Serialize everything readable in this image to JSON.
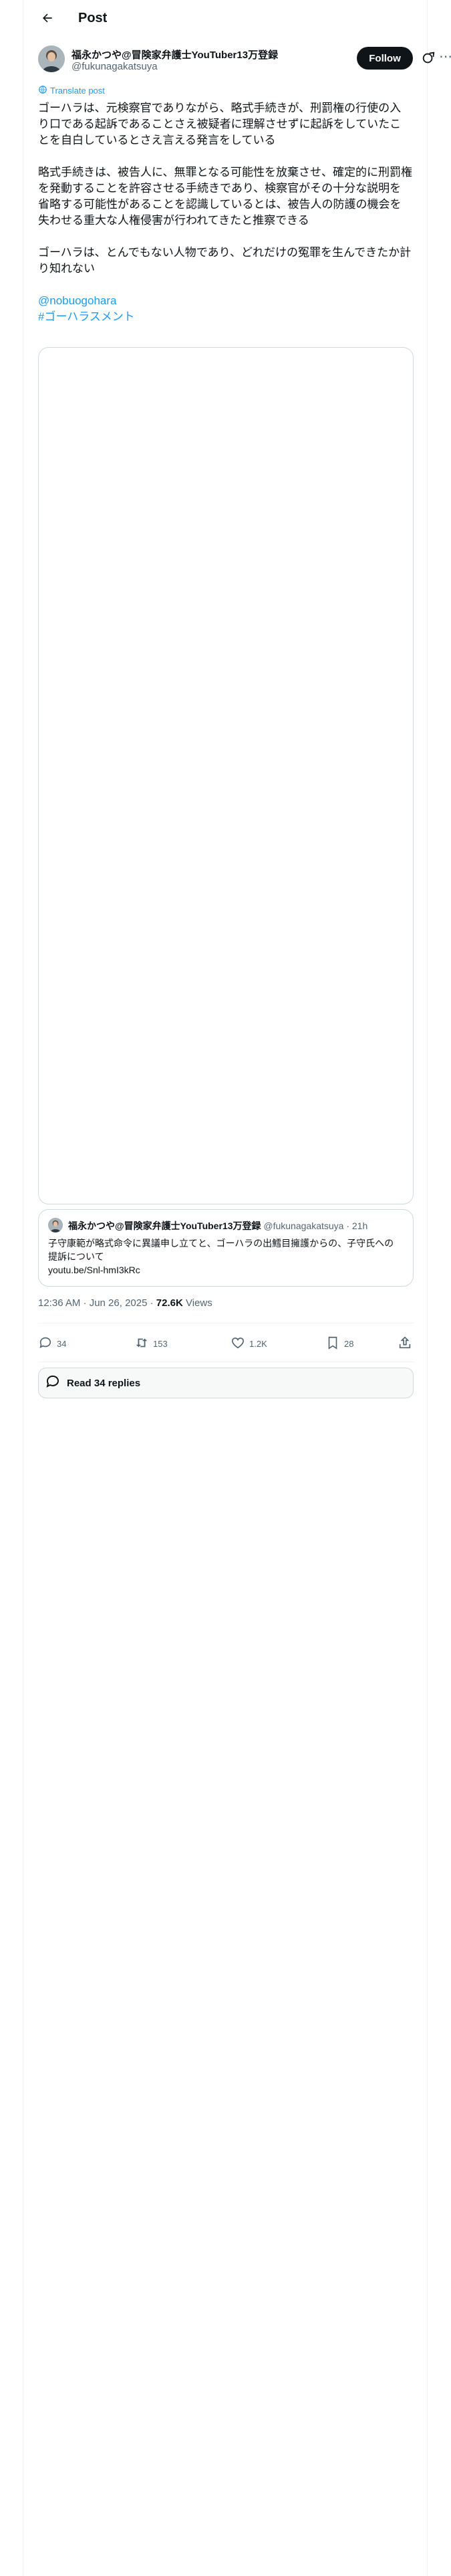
{
  "header": {
    "title": "Post"
  },
  "author": {
    "name": "福永かつや@冒険家弁護士YouTuber13万登録",
    "handle": "@fukunagakatsuya",
    "follow_label": "Follow"
  },
  "translate_label": "Translate post",
  "post": {
    "paragraphs": [
      "ゴーハラは、元検察官でありながら、略式手続きが、刑罰権の行使の入り口である起訴であることさえ被疑者に理解させずに起訴をしていたことを自白しているとさえ言える発言をしている",
      "略式手続きは、被告人に、無罪となる可能性を放棄させ、確定的に刑罰権を発動することを許容させる手続きであり、検察官がその十分な説明を省略する可能性があることを認識しているとは、被告人の防護の機会を失わせる重大な人権侵害が行われてきたと推察できる",
      "ゴーハラは、とんでもない人物であり、どれだけの冤罪を生んできたか計り知れない"
    ],
    "mention": "@nobuogohara",
    "hashtag": "#ゴーハラスメント"
  },
  "quote": {
    "name": "福永かつや@冒険家弁護士YouTuber13万登録",
    "handle": "@fukunagakatsuya",
    "time": "· 21h",
    "text": "子守康範が略式命令に異議申し立てと、ゴーハラの出鱈目擁護からの、子守氏への提訴について",
    "link": "youtu.be/Snl-hmI3kRc"
  },
  "meta": {
    "time_date": "12:36 AM · Jun 26, 2025 · ",
    "views_count": "72.6K",
    "views_label": " Views"
  },
  "actions": {
    "replies": "34",
    "reposts": "153",
    "likes": "1.2K",
    "bookmarks": "28"
  },
  "read_replies_label": "Read 34 replies"
}
